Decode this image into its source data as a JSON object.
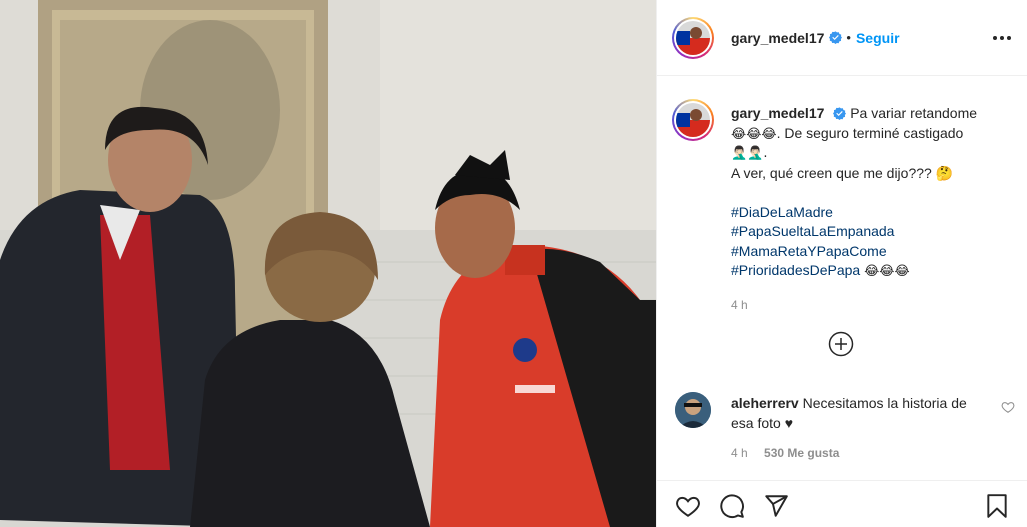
{
  "post": {
    "username": "gary_medel17",
    "follow_label": "Seguir",
    "dot": "•"
  },
  "caption": {
    "username": "gary_medel17",
    "line1": "Pa variar retandome",
    "line1_emoji": "😂😂😂",
    "line2": ". De seguro terminé castigado",
    "line3": "🤦🏻‍♂️🤦🏻‍♂️.",
    "line4": "A ver, qué creen que me dijo??? 🤔",
    "hashtags": [
      "#DiaDeLaMadre",
      "#PapaSueltaLaEmpanada",
      "#MamaRetaYPapaCome",
      "#PrioridadesDePapa"
    ],
    "last_hashtag_emoji": "😂😂😂",
    "time": "4 h"
  },
  "comment": {
    "username": "aleherrerv",
    "text": "Necesitamos la historia de esa foto ♥",
    "time": "4 h",
    "likes": "530 Me gusta"
  },
  "icons": {
    "verified": "verified-badge-icon",
    "more": "more-options-icon",
    "add": "load-more-comments-icon",
    "like": "heart-icon",
    "comment": "comment-icon",
    "share": "share-icon",
    "save": "bookmark-icon"
  },
  "colors": {
    "accent": "#0095f6",
    "hashtag": "#00376b",
    "muted": "#8e8e8e",
    "text": "#262626"
  }
}
